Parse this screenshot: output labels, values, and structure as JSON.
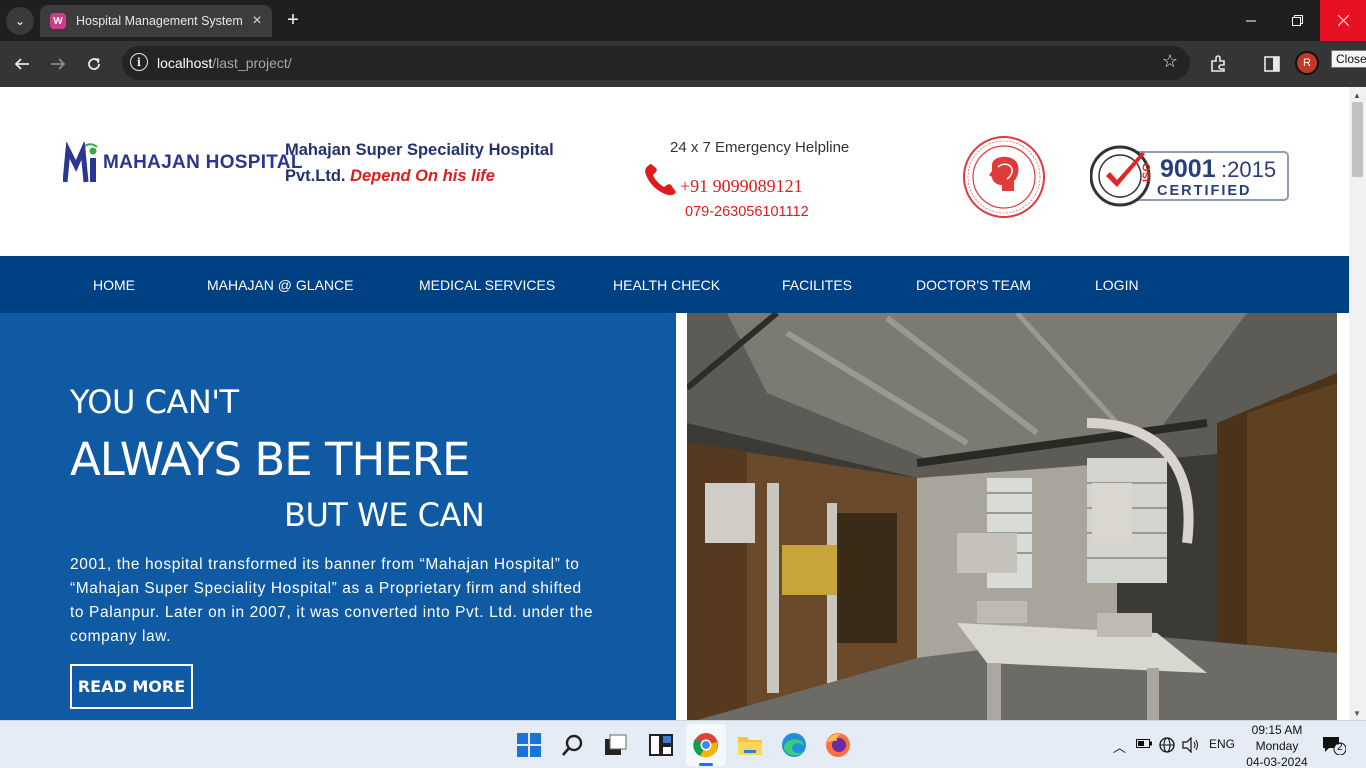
{
  "browser": {
    "tab_title": "Hospital Management System",
    "favicon_letter": "W",
    "new_tab_label": "+",
    "url_host": "localhost",
    "url_path": "/last_project/",
    "profile_initial": "R",
    "tooltip": "Close"
  },
  "header": {
    "logo_text": "MAHAJAN HOSPITAL",
    "hospital_name_line1": "Mahajan Super Speciality Hospital",
    "hospital_name_line2": "Pvt.Ltd.",
    "tagline": "Depend On his life",
    "helpline_title": "24 x 7 Emergency Helpline",
    "phone_primary": "+91 9099089121",
    "phone_secondary": "079-263056101112",
    "iso_number": "9001",
    "iso_year": ":2015",
    "iso_certified": "CERTIFIED",
    "iso_prefix": "ISO"
  },
  "nav": {
    "items": [
      {
        "label": "HOME"
      },
      {
        "label": "MAHAJAN @ GLANCE"
      },
      {
        "label": "MEDICAL SERVICES"
      },
      {
        "label": "HEALTH CHECK"
      },
      {
        "label": "FACILITES"
      },
      {
        "label": "DOCTOR'S TEAM"
      },
      {
        "label": "LOGIN"
      }
    ]
  },
  "hero": {
    "line1": "YOU CAN'T",
    "line2": "ALWAYS BE THERE",
    "line3": "BUT WE CAN",
    "description": "2001, the hospital transformed its banner from “Mahajan Hospital” to “Mahajan Super Speciality Hospital” as a Proprietary firm and shifted to Palanpur. Later on in 2007, it was converted into Pvt. Ltd. under the company law.",
    "button_label": "READ MORE"
  },
  "taskbar": {
    "language": "ENG",
    "time": "09:15 AM",
    "day": "Monday",
    "date": "04-03-2024",
    "notification_count": "2"
  },
  "colors": {
    "nav_bg": "#004183",
    "hero_bg": "#0f5aa3",
    "tagline": "#dd1c1c",
    "hospital_name": "#23336b"
  }
}
